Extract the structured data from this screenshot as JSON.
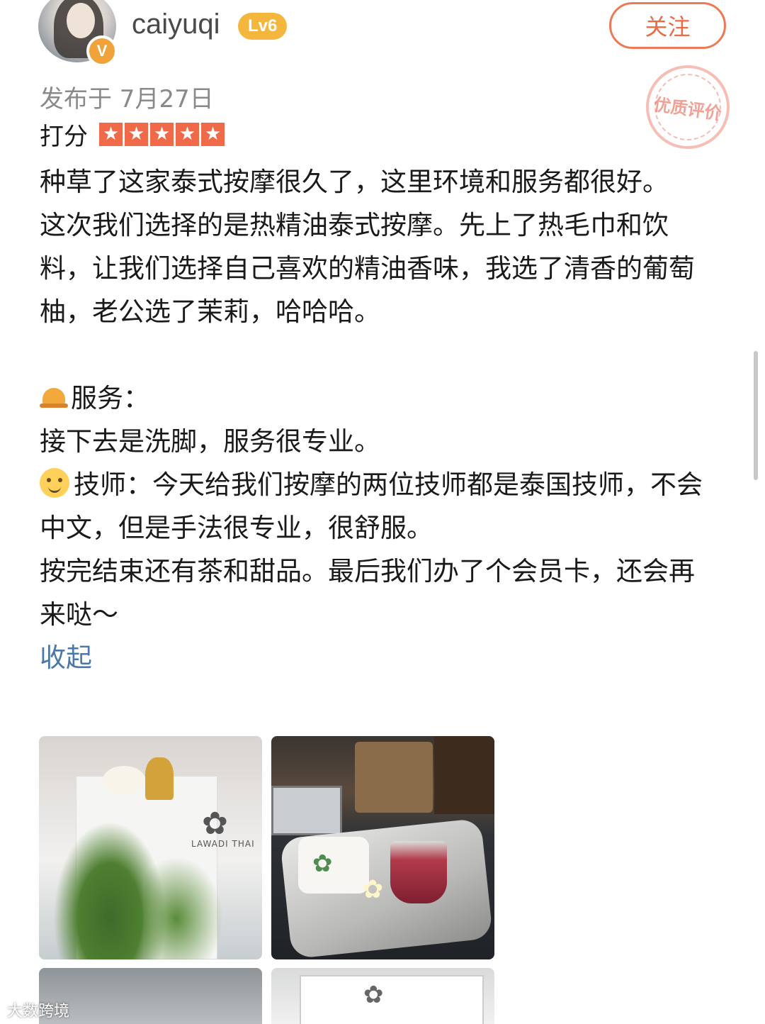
{
  "header": {
    "username": "caiyuqi",
    "level": "Lv6",
    "verified_badge": "V",
    "follow_label": "关注"
  },
  "stamp": {
    "text": "优质评价"
  },
  "meta": {
    "published": "发布于 7月27日",
    "rating_label": "打分",
    "rating_stars": 5
  },
  "review": {
    "paragraphs": [
      "种草了这家泰式按摩很久了，这里环境和服务都很好。",
      "这次我们选择的是热精油泰式按摩。先上了热毛巾和饮料，让我们选择自己喜欢的精油香味，我选了清香的葡萄柚，老公选了茉莉，哈哈哈。",
      "服务：",
      "接下去是洗脚，服务很专业。",
      "技师：今天给我们按摩的两位技师都是泰国技师，不会中文，但是手法很专业，很舒服。",
      "按完结束还有茶和甜品。最后我们办了个会员卡，还会再来哒～"
    ],
    "collapse_label": "收起"
  },
  "photos": {
    "logo_text": "LAWADI THAI"
  },
  "watermark": "大数跨境",
  "icons": {
    "bell": "bellhop-icon",
    "smile": "smiling-face-icon",
    "star": "star-icon"
  },
  "colors": {
    "accent": "#ec6a44",
    "star": "#f06a4a",
    "link": "#4a78a8",
    "level": "#f4b73e",
    "badge": "#f0a33a"
  }
}
